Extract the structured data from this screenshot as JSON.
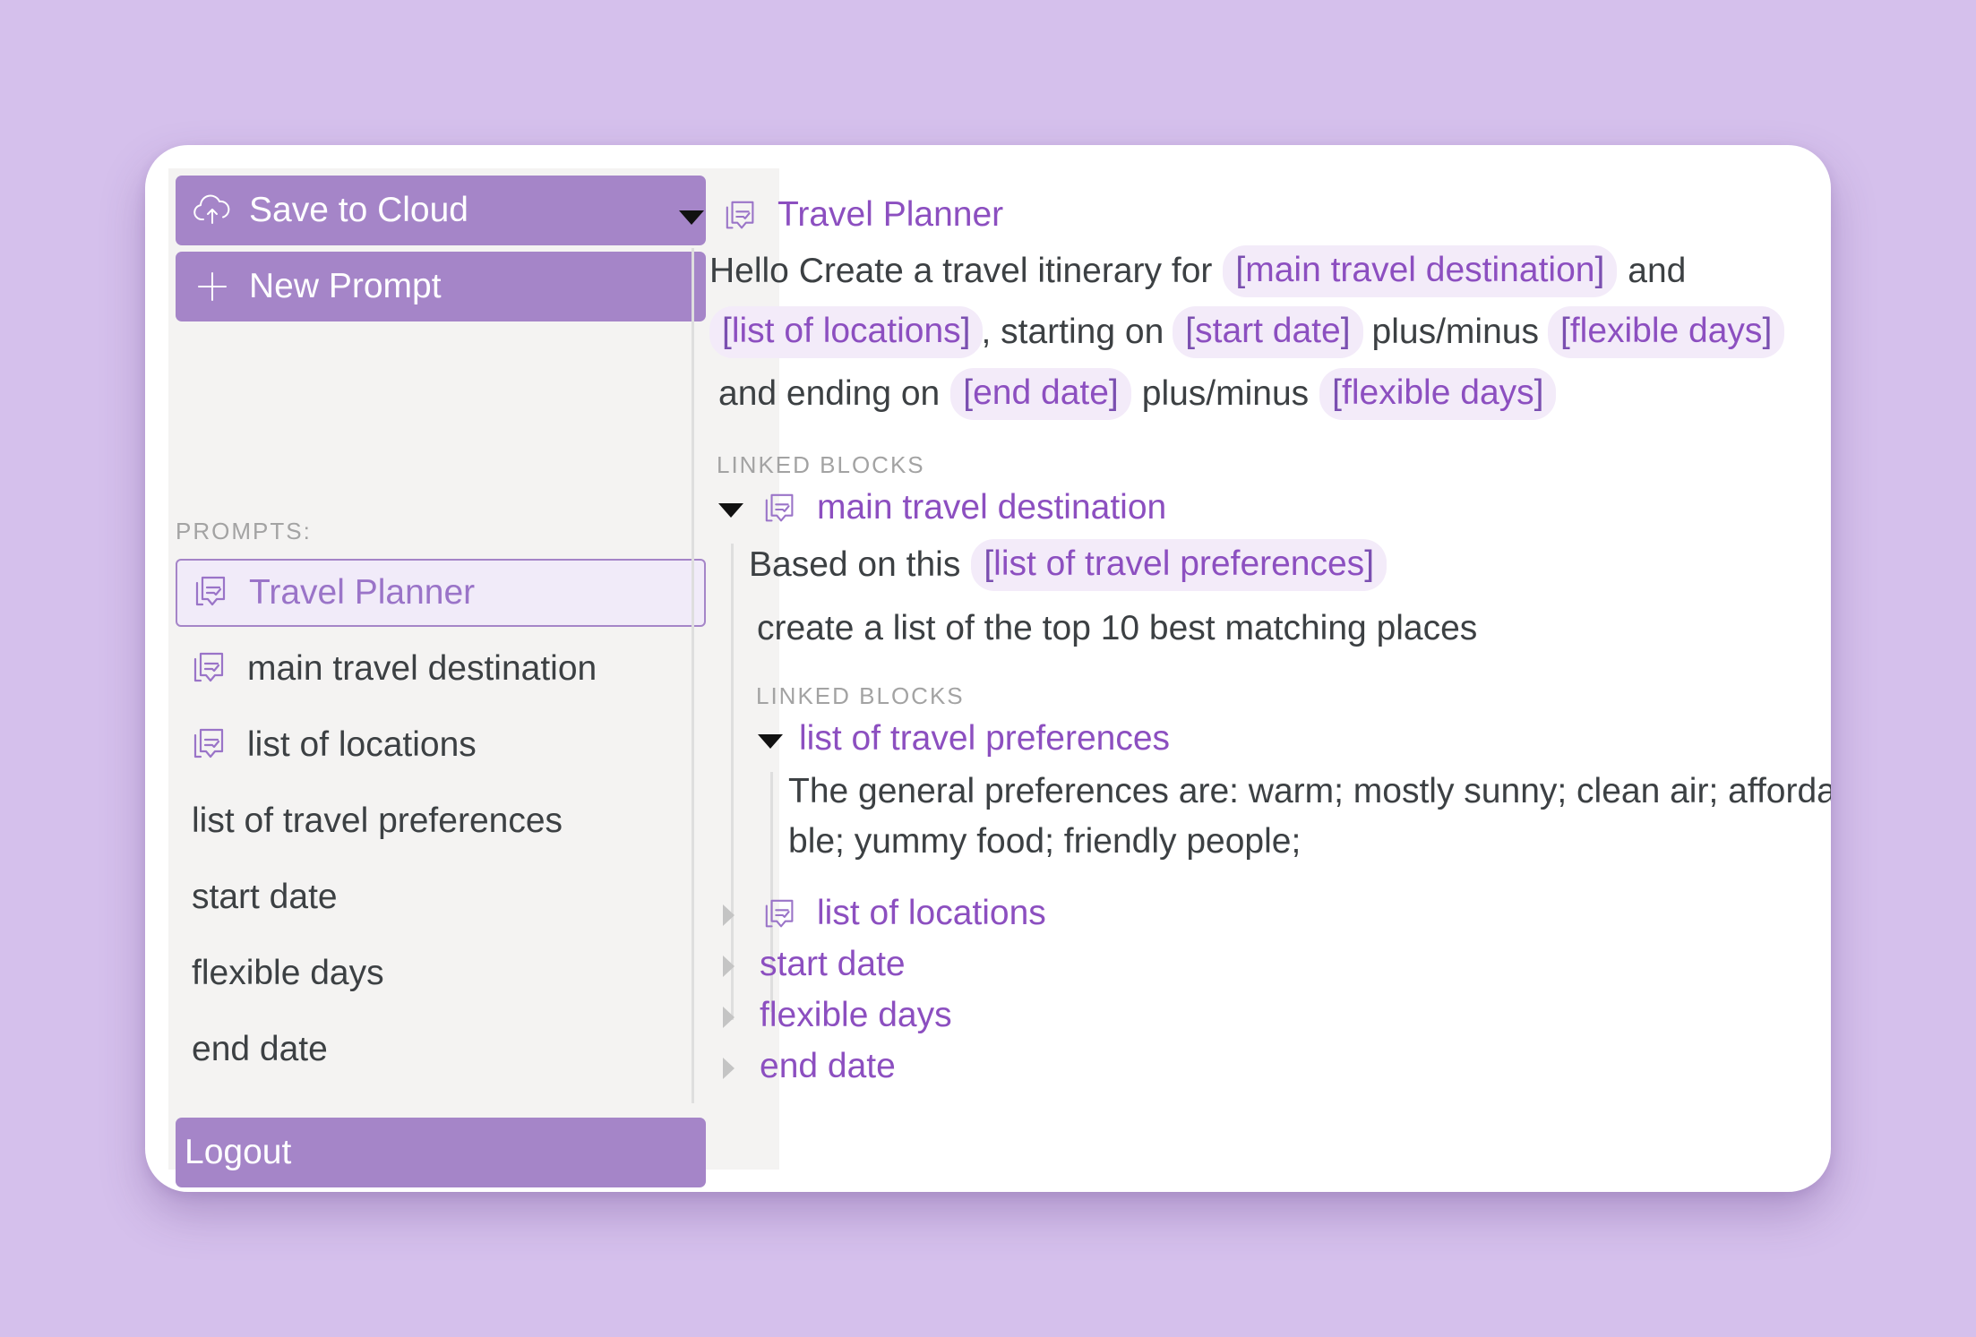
{
  "colors": {
    "background": "#d5c0ec",
    "accent": "#a585c8",
    "link": "#8c4fc0",
    "chip_bg": "#f3ebf9",
    "sidebar_bg": "#f4f3f2"
  },
  "sidebar": {
    "save_label": "Save to Cloud",
    "new_prompt_label": "New Prompt",
    "prompts_heading": "PROMPTS:",
    "items": [
      {
        "label": "Travel Planner",
        "icon": "prompt-icon"
      },
      {
        "label": "main travel destination",
        "icon": "prompt-icon"
      },
      {
        "label": "list of locations",
        "icon": "prompt-icon"
      },
      {
        "label": "list of travel preferences"
      },
      {
        "label": "start date"
      },
      {
        "label": "flexible days"
      },
      {
        "label": "end date"
      }
    ],
    "logout_label": "Logout"
  },
  "main": {
    "title": "Travel Planner",
    "body": {
      "p1": "Hello Create a travel itinerary for",
      "chip1": "main travel destination",
      "p2": "and",
      "chip2": "list of locations",
      "p3": ", starting on",
      "chip3": "start date",
      "p4": "plus/minus",
      "chip4": "flexible days",
      "p5": "and ending on",
      "chip5": "end date",
      "p6": "plus/minus",
      "chip6": "flexible days"
    },
    "linked_blocks_label": "LINKED BLOCKS",
    "linked": {
      "title": "main travel destination",
      "line1_text": "Based on this",
      "line1_chip": "list of travel preferences",
      "line2": "create a list of the top 10 best matching places",
      "linked_blocks_label": "LINKED BLOCKS",
      "nested": {
        "title": "list of travel preferences",
        "line1": "The general preferences are: warm; mostly sunny; clean air; afforda",
        "line2": "ble; yummy food; friendly people;"
      }
    },
    "collapsed": [
      {
        "label": "list of locations",
        "icon": "prompt-icon"
      },
      {
        "label": "start date"
      },
      {
        "label": "flexible days"
      },
      {
        "label": "end date"
      }
    ]
  }
}
